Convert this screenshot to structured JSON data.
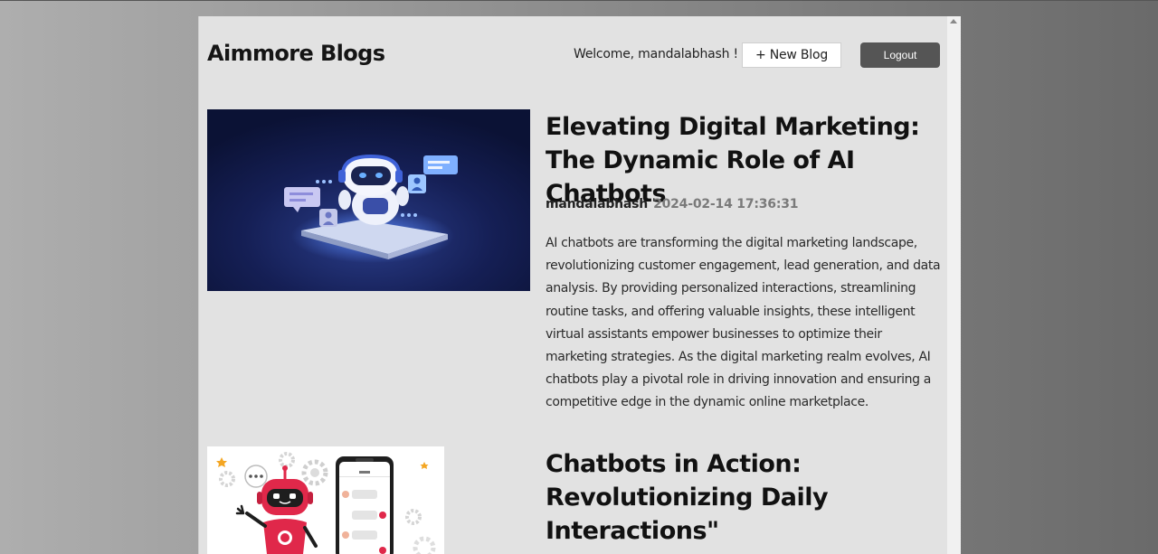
{
  "header": {
    "brand": "Aimmore Blogs",
    "welcome": "Welcome, mandalabhash !",
    "new_blog_label": "+ New Blog",
    "logout_label": "Logout"
  },
  "posts": [
    {
      "title": "Elevating Digital Marketing: The Dynamic Role of AI Chatbots",
      "author": "mandalabhash",
      "date": "2024-02-14 17:36:31",
      "excerpt": "AI chatbots are transforming the digital marketing landscape, revolutionizing customer engagement, lead generation, and data analysis. By providing personalized interactions, streamlining routine tasks, and offering valuable insights, these intelligent virtual assistants empower businesses to optimize their marketing strategies. As the digital marketing realm evolves, AI chatbots play a pivotal role in driving innovation and ensuring a competitive edge in the dynamic online marketplace."
    },
    {
      "title": "Chatbots in Action: Revolutionizing Daily Interactions\"",
      "author": "",
      "date": "",
      "excerpt": ""
    }
  ],
  "colors": {
    "page_bg": "#e2e2e2",
    "logout_bg": "#555555",
    "date_text": "#7a7a7a",
    "robot_red": "#e0284a"
  }
}
